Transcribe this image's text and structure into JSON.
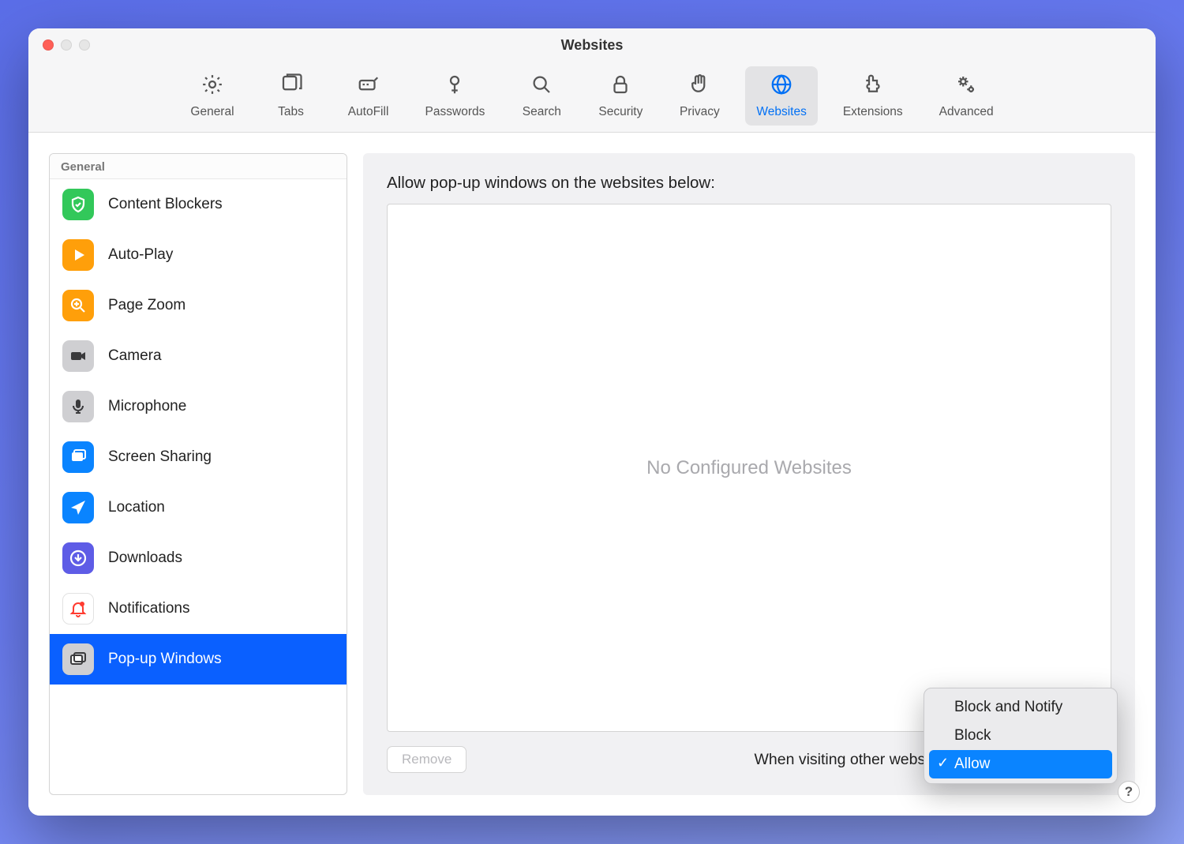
{
  "window": {
    "title": "Websites"
  },
  "tabs": [
    {
      "id": "general",
      "label": "General"
    },
    {
      "id": "tabs",
      "label": "Tabs"
    },
    {
      "id": "autofill",
      "label": "AutoFill"
    },
    {
      "id": "passwords",
      "label": "Passwords"
    },
    {
      "id": "search",
      "label": "Search"
    },
    {
      "id": "security",
      "label": "Security"
    },
    {
      "id": "privacy",
      "label": "Privacy"
    },
    {
      "id": "websites",
      "label": "Websites",
      "active": true
    },
    {
      "id": "extensions",
      "label": "Extensions"
    },
    {
      "id": "advanced",
      "label": "Advanced"
    }
  ],
  "sidebar": {
    "section_label": "General",
    "items": [
      {
        "label": "Content Blockers",
        "icon": "shield",
        "bg": "#32c85a"
      },
      {
        "label": "Auto-Play",
        "icon": "play",
        "bg": "#ff9f0a"
      },
      {
        "label": "Page Zoom",
        "icon": "zoom",
        "bg": "#ff9f0a"
      },
      {
        "label": "Camera",
        "icon": "camera",
        "bg": "#cfcfd2"
      },
      {
        "label": "Microphone",
        "icon": "mic",
        "bg": "#cfcfd2"
      },
      {
        "label": "Screen Sharing",
        "icon": "screens",
        "bg": "#0a84ff"
      },
      {
        "label": "Location",
        "icon": "arrow",
        "bg": "#0a84ff"
      },
      {
        "label": "Downloads",
        "icon": "download",
        "bg": "#5e5ce6"
      },
      {
        "label": "Notifications",
        "icon": "bell",
        "bg": "#ffffff"
      },
      {
        "label": "Pop-up Windows",
        "icon": "windows",
        "bg": "#cfcfd2",
        "selected": true
      }
    ]
  },
  "content": {
    "heading": "Allow pop-up windows on the websites below:",
    "empty_text": "No Configured Websites",
    "remove_label": "Remove",
    "footer_label": "When visiting other websites:",
    "dropdown_options": [
      {
        "label": "Block and Notify"
      },
      {
        "label": "Block"
      },
      {
        "label": "Allow",
        "selected": true
      }
    ]
  },
  "help_glyph": "?"
}
